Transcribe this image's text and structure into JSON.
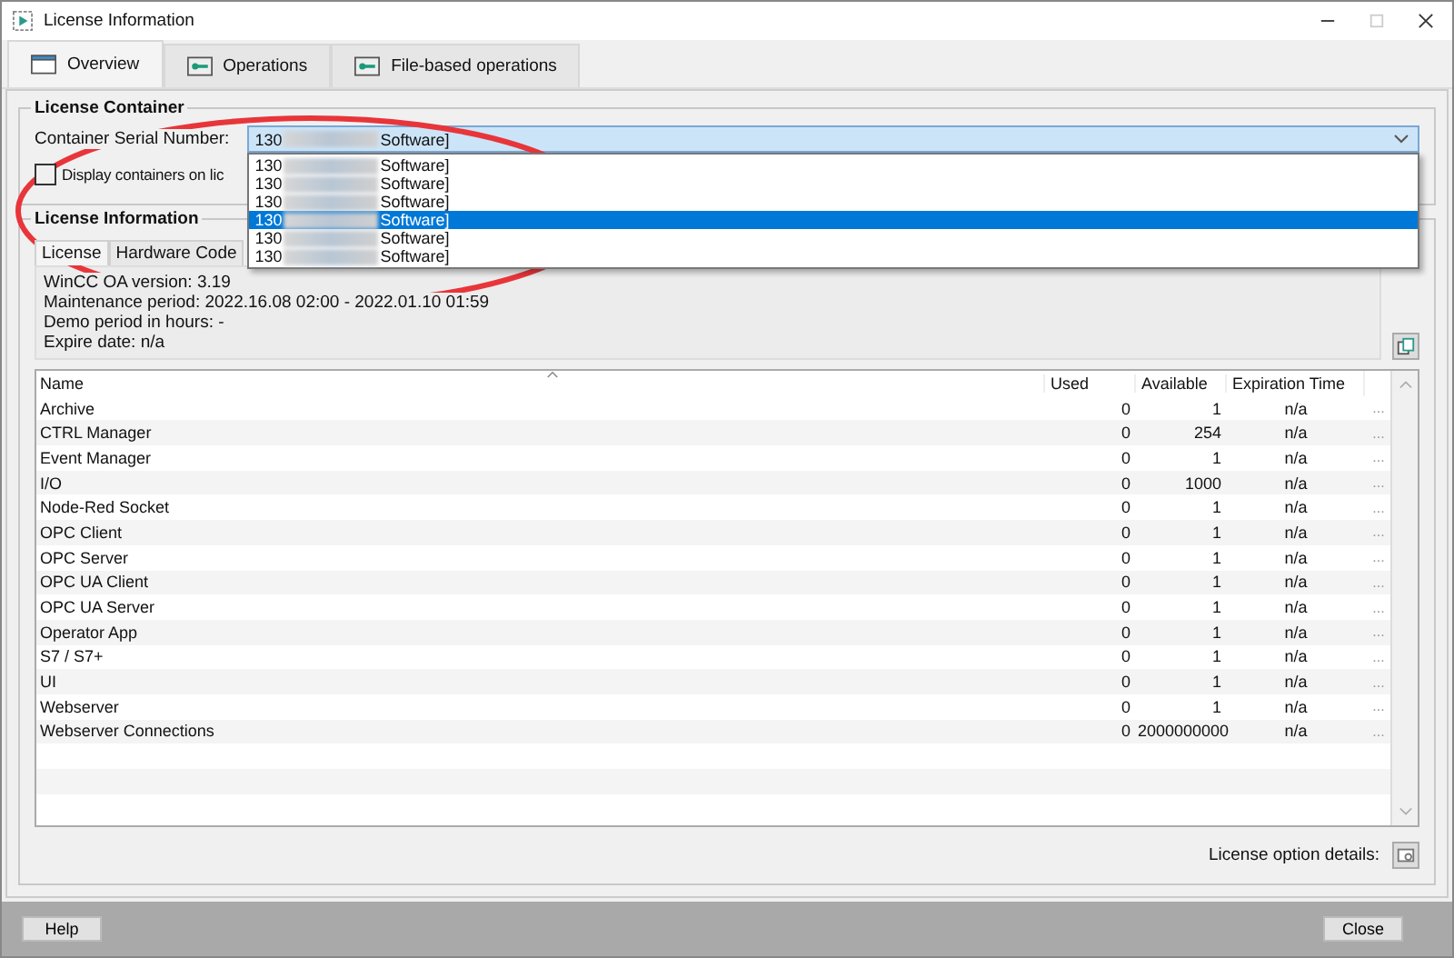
{
  "window": {
    "title": "License Information"
  },
  "tabs": [
    {
      "label": "Overview",
      "selected": true
    },
    {
      "label": "Operations",
      "selected": false
    },
    {
      "label": "File-based operations",
      "selected": false
    }
  ],
  "license_container": {
    "title": "License Container",
    "serial_label": "Container Serial Number:",
    "combo": {
      "prefix": "130",
      "suffix": "Software]",
      "expanded": true
    },
    "options": [
      {
        "prefix": "130",
        "suffix": "Software]",
        "selected": false
      },
      {
        "prefix": "130",
        "suffix": "Software]",
        "selected": false
      },
      {
        "prefix": "130",
        "suffix": "Software]",
        "selected": false
      },
      {
        "prefix": "130",
        "suffix": "Software]",
        "selected": true
      },
      {
        "prefix": "130",
        "suffix": "Software]",
        "selected": false
      },
      {
        "prefix": "130",
        "suffix": "Software]",
        "selected": false
      }
    ],
    "checkbox": {
      "label": "Display containers on lic",
      "checked": false
    }
  },
  "license_information": {
    "title": "License Information",
    "tabs": [
      {
        "label": "License",
        "selected": true
      },
      {
        "label": "Hardware Code",
        "selected": false
      }
    ],
    "details": [
      "WinCC OA version: 3.19",
      "Maintenance period: 2022.16.08 02:00 - 2022.01.10 01:59",
      "Demo period in hours: -",
      "Expire date: n/a"
    ],
    "table": {
      "columns": [
        "Name",
        "Used",
        "Available",
        "Expiration Time"
      ],
      "rows": [
        {
          "name": "Archive",
          "used": "0",
          "available": "1",
          "expiration": "n/a",
          "more": "..."
        },
        {
          "name": "CTRL Manager",
          "used": "0",
          "available": "254",
          "expiration": "n/a",
          "more": "..."
        },
        {
          "name": "Event Manager",
          "used": "0",
          "available": "1",
          "expiration": "n/a",
          "more": "..."
        },
        {
          "name": "I/O",
          "used": "0",
          "available": "1000",
          "expiration": "n/a",
          "more": "..."
        },
        {
          "name": "Node-Red Socket",
          "used": "0",
          "available": "1",
          "expiration": "n/a",
          "more": "..."
        },
        {
          "name": "OPC Client",
          "used": "0",
          "available": "1",
          "expiration": "n/a",
          "more": "..."
        },
        {
          "name": "OPC Server",
          "used": "0",
          "available": "1",
          "expiration": "n/a",
          "more": "..."
        },
        {
          "name": "OPC UA Client",
          "used": "0",
          "available": "1",
          "expiration": "n/a",
          "more": "..."
        },
        {
          "name": "OPC UA Server",
          "used": "0",
          "available": "1",
          "expiration": "n/a",
          "more": "..."
        },
        {
          "name": "Operator App",
          "used": "0",
          "available": "1",
          "expiration": "n/a",
          "more": "..."
        },
        {
          "name": "S7 / S7+",
          "used": "0",
          "available": "1",
          "expiration": "n/a",
          "more": "..."
        },
        {
          "name": "UI",
          "used": "0",
          "available": "1",
          "expiration": "n/a",
          "more": "..."
        },
        {
          "name": "Webserver",
          "used": "0",
          "available": "1",
          "expiration": "n/a",
          "more": "..."
        },
        {
          "name": "Webserver Connections",
          "used": "0",
          "available": "2000000000",
          "expiration": "n/a",
          "more": "..."
        }
      ]
    },
    "option_details_label": "License option details:"
  },
  "buttons": [
    {
      "label": "Help"
    },
    {
      "label": "Close"
    }
  ]
}
